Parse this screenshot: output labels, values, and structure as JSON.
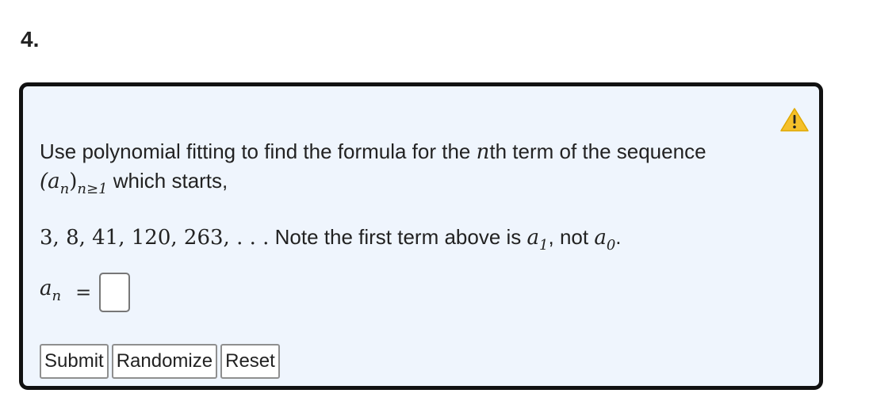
{
  "exercise": {
    "number": "4."
  },
  "problem": {
    "warning_icon": "warning-triangle-icon",
    "line1_text": "Use polynomial fitting to find the formula for the ",
    "line1_var": "n",
    "line1_text_end": "th term of the sequence",
    "line2_seq": "(a",
    "line2_seq_sub_n": "n",
    "line2_seq_close": ")",
    "line2_seq_sub_index": "n≥1",
    "line2_text": " which starts,",
    "sequence_values": "3, 8, 41, 120, 263, . . .",
    "note_text": " Note the first term above is ",
    "note_a1": "a",
    "note_a1_sub": "1",
    "note_mid": ", not ",
    "note_a0": "a",
    "note_a0_sub": "0",
    "note_end": "."
  },
  "answer": {
    "label_var": "a",
    "label_sub": "n",
    "equals": "=",
    "value": "",
    "placeholder": ""
  },
  "buttons": {
    "submit": "Submit",
    "randomize": "Randomize",
    "reset": "Reset"
  },
  "colors": {
    "box_background": "#eff5fd",
    "box_border": "#111111",
    "warning_fill": "#f5c02b"
  }
}
